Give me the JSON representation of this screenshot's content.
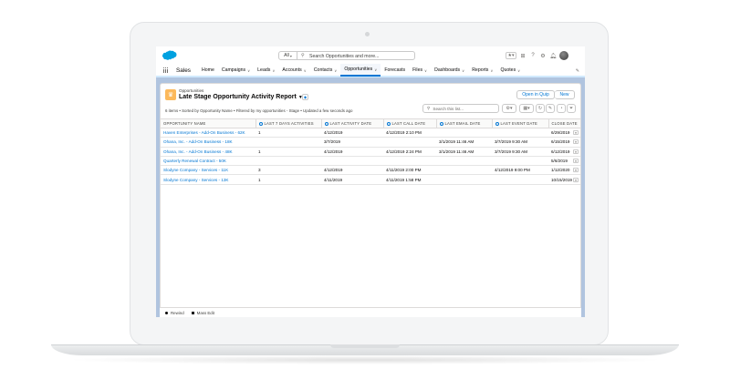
{
  "header": {
    "search_scope": "All",
    "search_placeholder": "Search Opportunities and more..."
  },
  "nav": {
    "app_name": "Sales",
    "items": [
      {
        "label": "Home",
        "dropdown": false
      },
      {
        "label": "Campaigns",
        "dropdown": true
      },
      {
        "label": "Leads",
        "dropdown": true
      },
      {
        "label": "Accounts",
        "dropdown": true
      },
      {
        "label": "Contacts",
        "dropdown": true
      },
      {
        "label": "Opportunities",
        "dropdown": true,
        "active": true
      },
      {
        "label": "Forecasts",
        "dropdown": false
      },
      {
        "label": "Files",
        "dropdown": true
      },
      {
        "label": "Dashboards",
        "dropdown": true
      },
      {
        "label": "Reports",
        "dropdown": true
      },
      {
        "label": "Quotes",
        "dropdown": true
      }
    ]
  },
  "list": {
    "object_name": "Opportunities",
    "list_name": "Late Stage Opportunity Activity Report",
    "open_in_quip": "Open in Quip",
    "new_label": "New",
    "meta": "6 items • Sorted by Opportunity Name • Filtered by my opportunities - Stage • Updated a few seconds ago",
    "search_placeholder": "Search this list..."
  },
  "table": {
    "columns": [
      "OPPORTUNITY NAME",
      "LAST 7 DAYS ACTIVITIES",
      "LAST ACTIVITY DATE",
      "LAST CALL DATE",
      "LAST EMAIL DATE",
      "LAST EVENT DATE",
      "CLOSE DATE"
    ],
    "rows": [
      [
        "Haven Enterprises - Add-On Business - 62K",
        "1",
        "4/12/2019",
        "4/12/2019 2:10 PM",
        "",
        "",
        "6/29/2019"
      ],
      [
        "Ohana, Inc. - Add-On Business - 18K",
        "",
        "3/7/2019",
        "",
        "3/1/2019 11:46 AM",
        "3/7/2019 9:30 AM",
        "6/15/2019"
      ],
      [
        "Ohana, Inc. - Add-On Business - 48K",
        "1",
        "4/12/2019",
        "4/12/2019 2:24 PM",
        "3/1/2019 11:46 AM",
        "3/7/2019 9:30 AM",
        "6/12/2019"
      ],
      [
        "Quarterly Renewal Contract - 50K",
        "",
        "",
        "",
        "",
        "",
        "5/6/2019"
      ],
      [
        "Slodyne Company - Services - 11K",
        "3",
        "4/12/2019",
        "4/11/2019 2:00 PM",
        "",
        "4/12/2019 9:00 PM",
        "1/12/2020"
      ],
      [
        "Slodyne Company - Services - 13K",
        "1",
        "4/11/2019",
        "4/11/2019 1:58 PM",
        "",
        "",
        "10/15/2019"
      ]
    ]
  },
  "footer": {
    "rewind": "Rewind",
    "mass_edit": "Mass Edit"
  },
  "colors": {
    "brand": "#00a1e0",
    "link": "#0176d3",
    "list_icon": "#fcb95b"
  }
}
